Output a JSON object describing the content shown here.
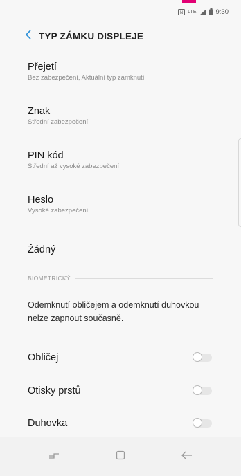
{
  "status_bar": {
    "network": "LTE",
    "time": "9:30"
  },
  "header": {
    "back_icon": "chevron-left-icon",
    "title": "TYP ZÁMKU DISPLEJE"
  },
  "lock_options": [
    {
      "title": "Přejetí",
      "subtitle": "Bez zabezpečení, Aktuální typ zamknutí"
    },
    {
      "title": "Znak",
      "subtitle": "Střední zabezpečení"
    },
    {
      "title": "PIN kód",
      "subtitle": "Střední až vysoké zabezpečení"
    },
    {
      "title": "Heslo",
      "subtitle": "Vysoké zabezpečení"
    },
    {
      "title": "Žádný",
      "subtitle": ""
    }
  ],
  "biometrics": {
    "section_label": "BIOMETRICKÝ",
    "note": "Odemknutí obličejem a odemknutí duhovkou nelze zapnout současně.",
    "toggles": [
      {
        "label": "Obličej",
        "enabled": false
      },
      {
        "label": "Otisky prstů",
        "enabled": false
      },
      {
        "label": "Duhovka",
        "enabled": false
      }
    ]
  },
  "colors": {
    "accent": "#2a8fd8",
    "brand": "#e20074",
    "toggle_off": "#e6e6e6"
  },
  "nav_bar": {
    "recents_icon": "recent-apps-icon",
    "home_icon": "home-icon",
    "back_icon": "back-arrow-icon"
  }
}
